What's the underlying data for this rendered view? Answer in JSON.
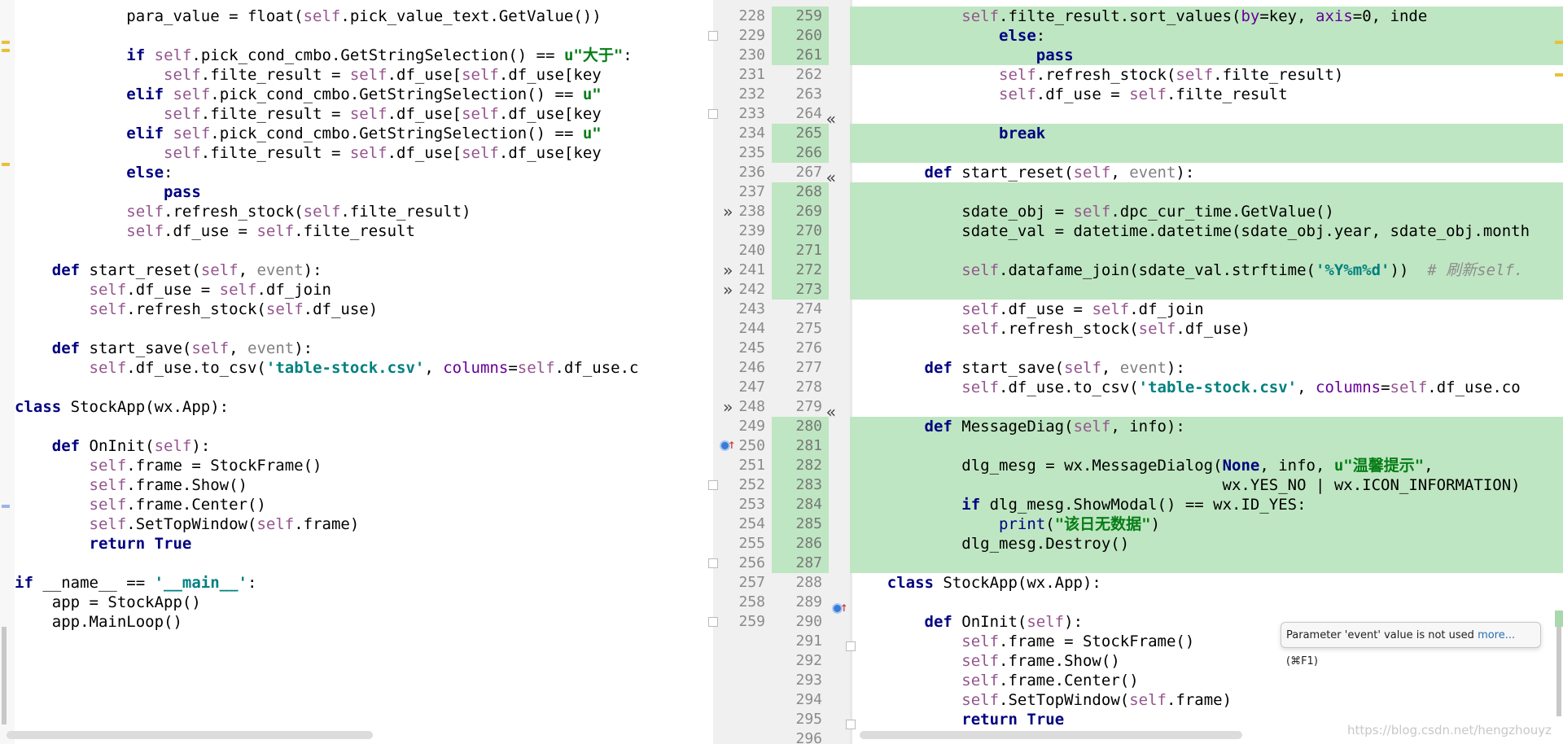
{
  "editor": {
    "left_pane": {
      "lines": [
        "            para_value = float(self.pick_value_text.GetValue())",
        "",
        "            if self.pick_cond_cmbo.GetStringSelection() == u\"大于\":",
        "                self.filte_result = self.df_use[self.df_use[key",
        "            elif self.pick_cond_cmbo.GetStringSelection() == u\"",
        "                self.filte_result = self.df_use[self.df_use[key",
        "            elif self.pick_cond_cmbo.GetStringSelection() == u\"",
        "                self.filte_result = self.df_use[self.df_use[key",
        "            else:",
        "                pass",
        "            self.refresh_stock(self.filte_result)",
        "            self.df_use = self.filte_result",
        "",
        "    def start_reset(self, event):",
        "        self.df_use = self.df_join",
        "        self.refresh_stock(self.df_use)",
        "",
        "    def start_save(self, event):",
        "        self.df_use.to_csv('table-stock.csv', columns=self.df_use.c",
        "",
        "class StockApp(wx.App):",
        "",
        "    def OnInit(self):",
        "        self.frame = StockFrame()",
        "        self.frame.Show()",
        "        self.frame.Center()",
        "        self.SetTopWindow(self.frame)",
        "        return True",
        "",
        "if __name__ == '__main__':",
        "    app = StockApp()",
        "    app.MainLoop()"
      ],
      "line_numbers": [
        "228",
        "229",
        "230",
        "231",
        "232",
        "233",
        "234",
        "235",
        "236",
        "237",
        "238",
        "239",
        "240",
        "241",
        "242",
        "243",
        "244",
        "245",
        "246",
        "247",
        "248",
        "249",
        "250",
        "251",
        "252",
        "253",
        "254",
        "255",
        "256",
        "257",
        "258",
        "259"
      ]
    },
    "right_pane": {
      "lines": [
        "            self.filte_result.sort_values(by=key, axis=0, inde",
        "                else:",
        "                    pass",
        "                self.refresh_stock(self.filte_result)",
        "                self.df_use = self.filte_result",
        "",
        "                break",
        "",
        "        def start_reset(self, event):",
        "",
        "            sdate_obj = self.dpc_cur_time.GetValue()",
        "            sdate_val = datetime.datetime(sdate_obj.year, sdate_obj.month",
        "",
        "            self.datafame_join(sdate_val.strftime('%Y%m%d'))  # 刷新self.",
        "",
        "            self.df_use = self.df_join",
        "            self.refresh_stock(self.df_use)",
        "",
        "        def start_save(self, event):",
        "            self.df_use.to_csv('table-stock.csv', columns=self.df_use.co",
        "",
        "        def MessageDiag(self, info):",
        "",
        "            dlg_mesg = wx.MessageDialog(None, info, u\"温馨提示\",",
        "                                        wx.YES_NO | wx.ICON_INFORMATION)",
        "            if dlg_mesg.ShowModal() == wx.ID_YES:",
        "                print(\"该日无数据\")",
        "            dlg_mesg.Destroy()",
        "",
        "    class StockApp(wx.App):",
        "",
        "        def OnInit(self):",
        "            self.frame = StockFrame()",
        "            self.frame.Show()",
        "            self.frame.Center()",
        "            self.SetTopWindow(self.frame)",
        "            return True",
        ""
      ],
      "line_numbers": [
        "259",
        "260",
        "261",
        "262",
        "263",
        "264",
        "265",
        "266",
        "267",
        "268",
        "269",
        "270",
        "271",
        "272",
        "273",
        "274",
        "275",
        "276",
        "277",
        "278",
        "279",
        "280",
        "281",
        "282",
        "283",
        "284",
        "285",
        "286",
        "287",
        "288",
        "289",
        "290",
        "291",
        "292",
        "293",
        "294",
        "295",
        "296"
      ]
    },
    "tooltip": {
      "text": "Parameter 'event' value is not used",
      "link": "more...",
      "shortcut": "(⌘F1)"
    },
    "watermark": "https://blog.csdn.net/hengzhouyz"
  }
}
